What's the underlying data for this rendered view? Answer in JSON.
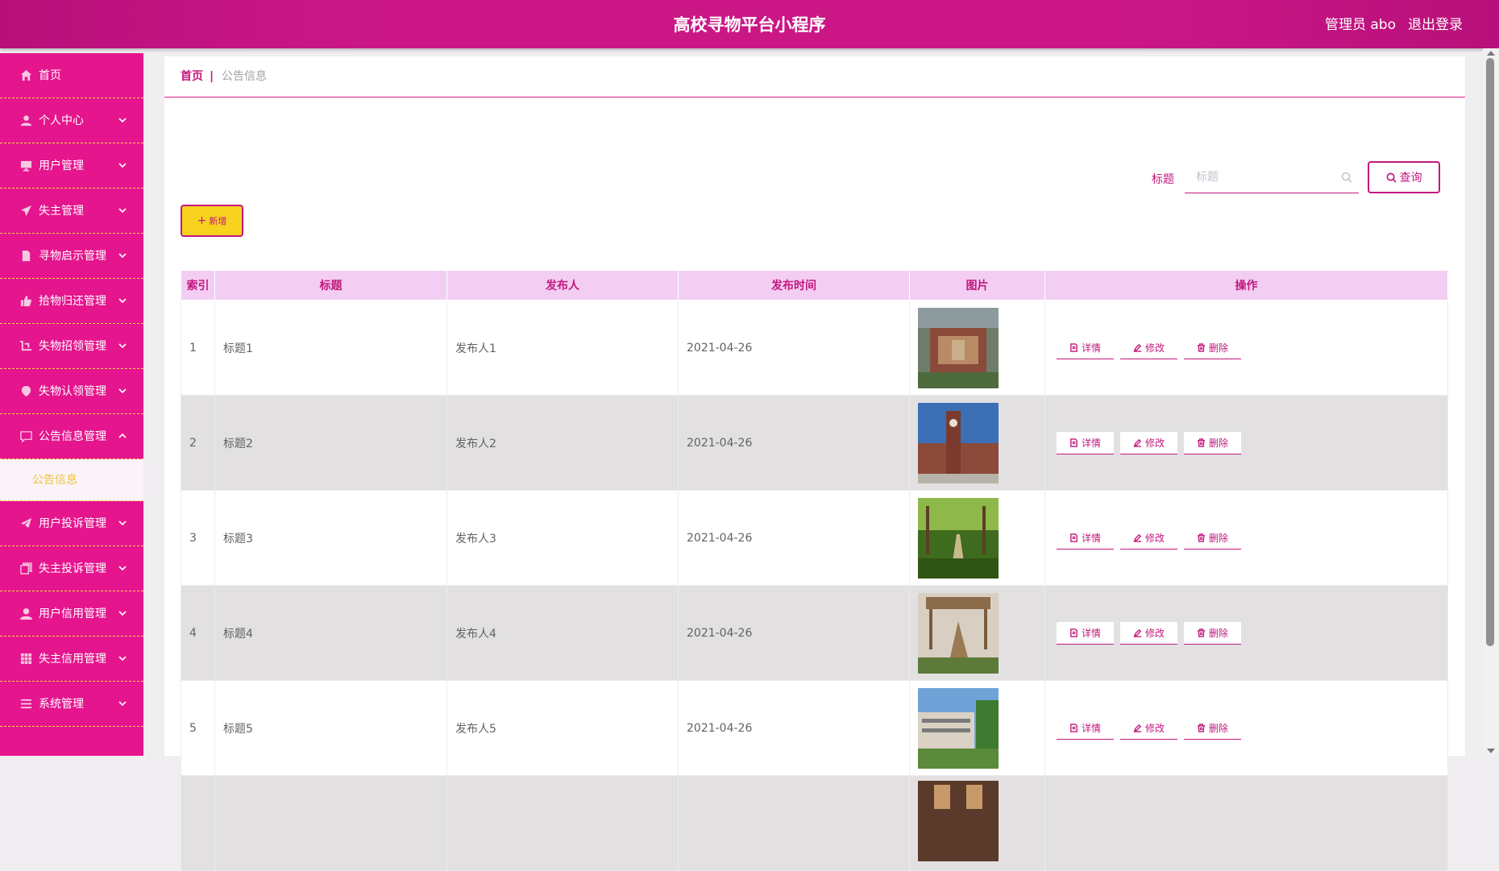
{
  "header": {
    "title": "高校寻物平台小程序",
    "user": "管理员 abo",
    "logout": "退出登录"
  },
  "sidebar": {
    "items": [
      {
        "label": "首页",
        "icon": "home-icon",
        "arrow": false
      },
      {
        "label": "个人中心",
        "icon": "user-icon",
        "arrow": true
      },
      {
        "label": "用户管理",
        "icon": "monitor-icon",
        "arrow": true
      },
      {
        "label": "失主管理",
        "icon": "send-icon",
        "arrow": true
      },
      {
        "label": "寻物启示管理",
        "icon": "document-icon",
        "arrow": true
      },
      {
        "label": "拾物归还管理",
        "icon": "thumb-icon",
        "arrow": true
      },
      {
        "label": "失物招领管理",
        "icon": "crop-icon",
        "arrow": true
      },
      {
        "label": "失物认领管理",
        "icon": "location-icon",
        "arrow": true
      },
      {
        "label": "公告信息管理",
        "icon": "message-icon",
        "arrow": true,
        "expanded": true
      }
    ],
    "submenu": {
      "label": "公告信息"
    },
    "items_after": [
      {
        "label": "用户投诉管理",
        "icon": "paper-plane-icon"
      },
      {
        "label": "失主投诉管理",
        "icon": "copy-icon"
      },
      {
        "label": "用户信用管理",
        "icon": "user-solid-icon"
      },
      {
        "label": "失主信用管理",
        "icon": "grid-icon"
      },
      {
        "label": "系统管理",
        "icon": "list-icon"
      }
    ]
  },
  "breadcrumb": {
    "home": "首页",
    "separator": "|",
    "current": "公告信息"
  },
  "search": {
    "label": "标题",
    "placeholder": "标题",
    "button": "查询"
  },
  "toolbar": {
    "add_label": "新增"
  },
  "table": {
    "headers": [
      "索引",
      "标题",
      "发布人",
      "发布时间",
      "图片",
      "操作"
    ],
    "rows": [
      {
        "index": "1",
        "title": "标题1",
        "publisher": "发布人1",
        "time": "2021-04-26",
        "image": "campus-aerial"
      },
      {
        "index": "2",
        "title": "标题2",
        "publisher": "发布人2",
        "time": "2021-04-26",
        "image": "clock-tower"
      },
      {
        "index": "3",
        "title": "标题3",
        "publisher": "发布人3",
        "time": "2021-04-26",
        "image": "tree-path"
      },
      {
        "index": "4",
        "title": "标题4",
        "publisher": "发布人4",
        "time": "2021-04-26",
        "image": "sculpture"
      },
      {
        "index": "5",
        "title": "标题5",
        "publisher": "发布人5",
        "time": "2021-04-26",
        "image": "building"
      },
      {
        "index": "",
        "title": "",
        "publisher": "",
        "time": "",
        "image": "interior"
      }
    ],
    "actions": {
      "detail": "详情",
      "edit": "修改",
      "delete": "删除"
    }
  },
  "colors": {
    "header": "#cb1786",
    "sidebar": "#e5158e",
    "accent": "#c2187e",
    "table_header": "#f3cef2",
    "add_button": "#f7d21e"
  }
}
